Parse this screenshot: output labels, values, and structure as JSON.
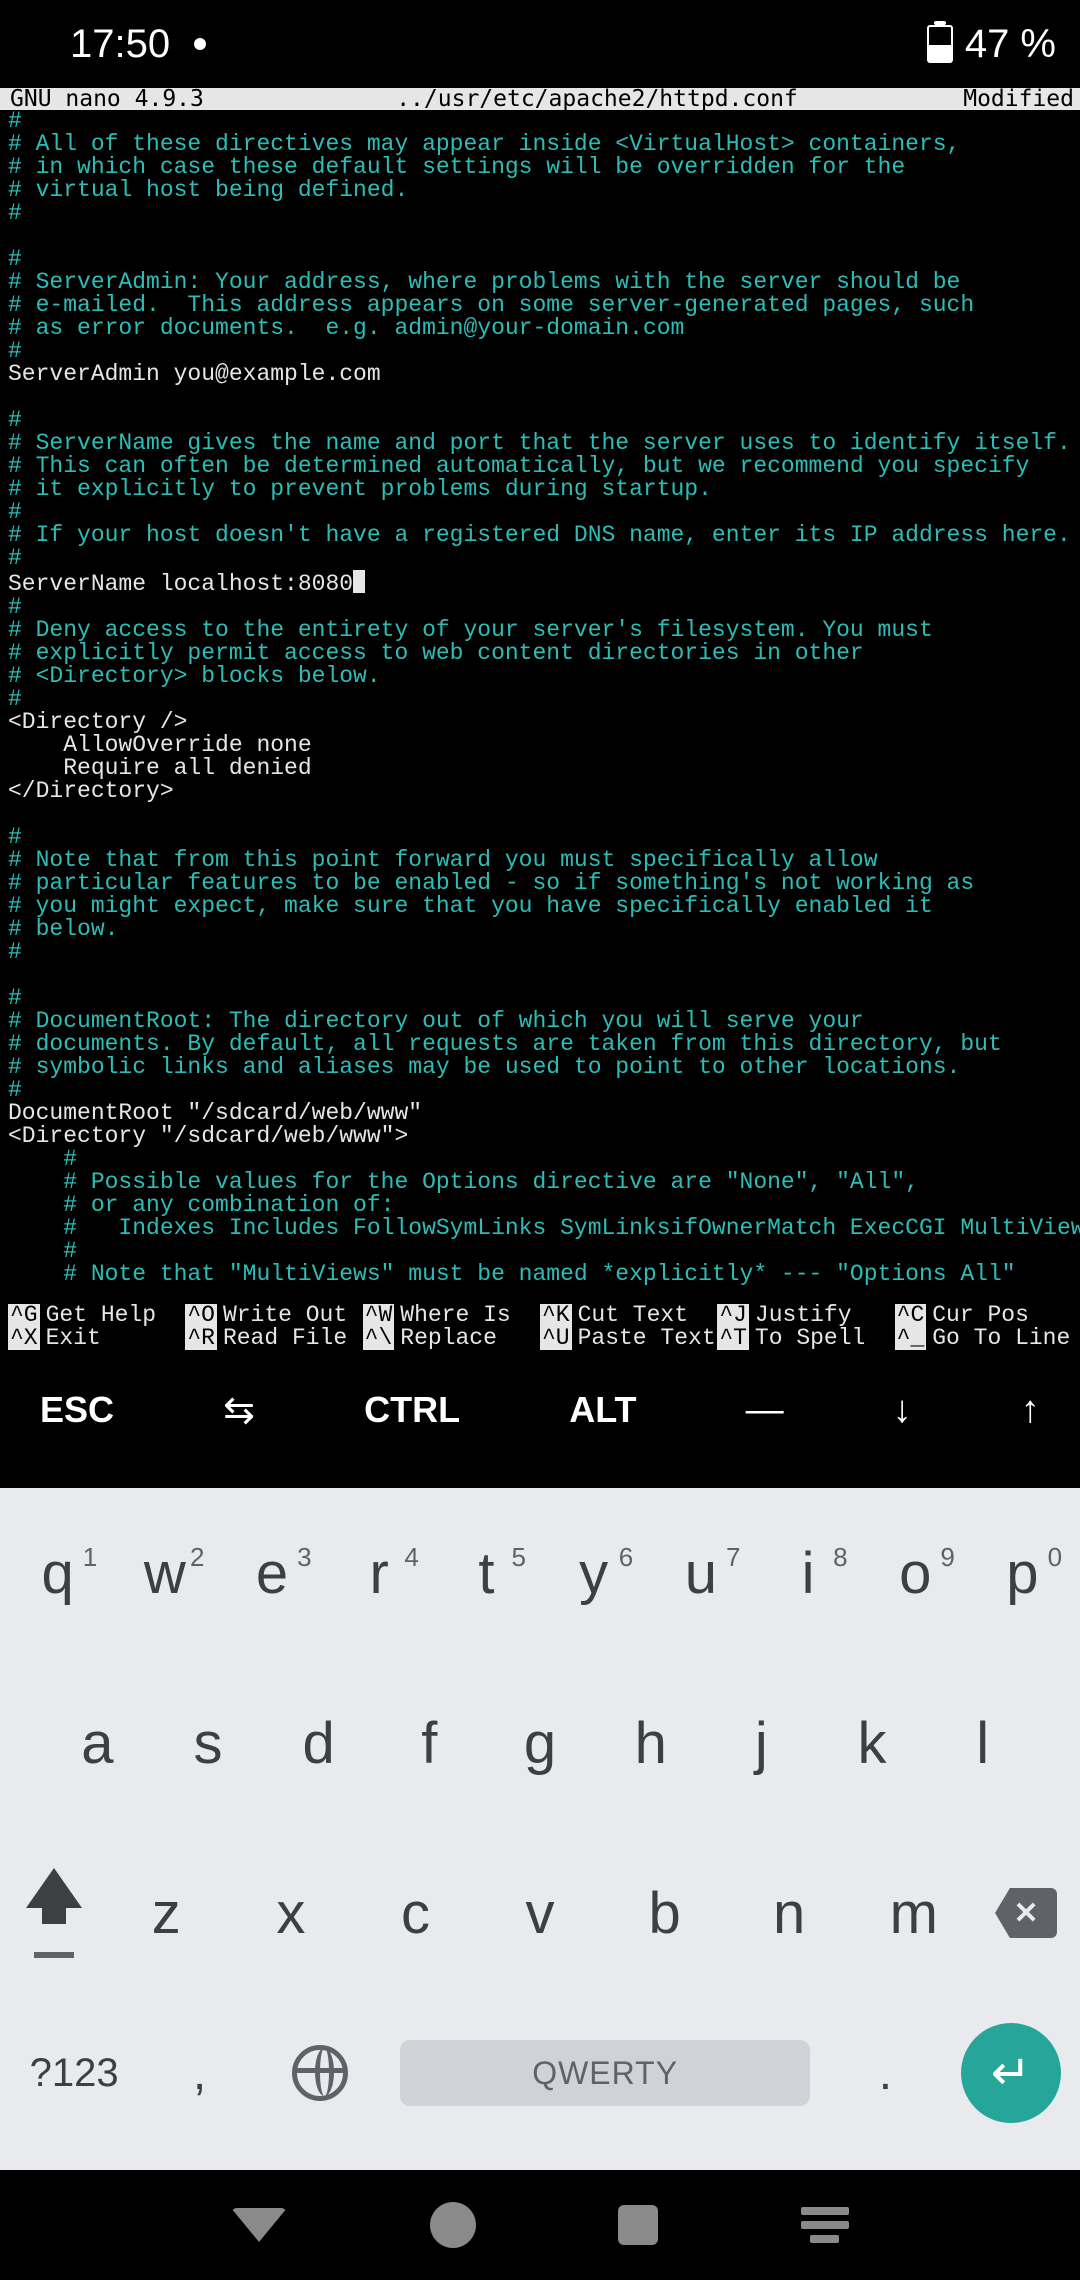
{
  "status": {
    "time": "17:50",
    "battery": "47 %"
  },
  "nano": {
    "app": "GNU nano 4.9.3",
    "file": "../usr/etc/apache2/httpd.conf",
    "state": "Modified",
    "lines": [
      {
        "t": "c",
        "v": "#"
      },
      {
        "t": "c",
        "v": "# All of these directives may appear inside <VirtualHost> containers,"
      },
      {
        "t": "c",
        "v": "# in which case these default settings will be overridden for the"
      },
      {
        "t": "c",
        "v": "# virtual host being defined."
      },
      {
        "t": "c",
        "v": "#"
      },
      {
        "t": "b",
        "v": ""
      },
      {
        "t": "c",
        "v": "#"
      },
      {
        "t": "c",
        "v": "# ServerAdmin: Your address, where problems with the server should be"
      },
      {
        "t": "c",
        "v": "# e-mailed.  This address appears on some server-generated pages, such"
      },
      {
        "t": "c",
        "v": "# as error documents.  e.g. admin@your-domain.com"
      },
      {
        "t": "c",
        "v": "#"
      },
      {
        "t": "p",
        "v": "ServerAdmin you@example.com"
      },
      {
        "t": "b",
        "v": ""
      },
      {
        "t": "c",
        "v": "#"
      },
      {
        "t": "c",
        "v": "# ServerName gives the name and port that the server uses to identify itself."
      },
      {
        "t": "c",
        "v": "# This can often be determined automatically, but we recommend you specify"
      },
      {
        "t": "c",
        "v": "# it explicitly to prevent problems during startup."
      },
      {
        "t": "c",
        "v": "#"
      },
      {
        "t": "c",
        "v": "# If your host doesn't have a registered DNS name, enter its IP address here."
      },
      {
        "t": "c",
        "v": "#"
      },
      {
        "t": "p",
        "v": "ServerName localhost:8080",
        "cursor": true
      },
      {
        "t": "c",
        "v": "#"
      },
      {
        "t": "c",
        "v": "# Deny access to the entirety of your server's filesystem. You must"
      },
      {
        "t": "c",
        "v": "# explicitly permit access to web content directories in other"
      },
      {
        "t": "c",
        "v": "# <Directory> blocks below."
      },
      {
        "t": "c",
        "v": "#"
      },
      {
        "t": "p",
        "v": "<Directory />"
      },
      {
        "t": "p",
        "v": "    AllowOverride none"
      },
      {
        "t": "p",
        "v": "    Require all denied"
      },
      {
        "t": "p",
        "v": "</Directory>"
      },
      {
        "t": "b",
        "v": ""
      },
      {
        "t": "c",
        "v": "#"
      },
      {
        "t": "c",
        "v": "# Note that from this point forward you must specifically allow"
      },
      {
        "t": "c",
        "v": "# particular features to be enabled - so if something's not working as"
      },
      {
        "t": "c",
        "v": "# you might expect, make sure that you have specifically enabled it"
      },
      {
        "t": "c",
        "v": "# below."
      },
      {
        "t": "c",
        "v": "#"
      },
      {
        "t": "b",
        "v": ""
      },
      {
        "t": "c",
        "v": "#"
      },
      {
        "t": "c",
        "v": "# DocumentRoot: The directory out of which you will serve your"
      },
      {
        "t": "c",
        "v": "# documents. By default, all requests are taken from this directory, but"
      },
      {
        "t": "c",
        "v": "# symbolic links and aliases may be used to point to other locations."
      },
      {
        "t": "c",
        "v": "#"
      },
      {
        "t": "p",
        "v": "DocumentRoot \"/sdcard/web/www\""
      },
      {
        "t": "p",
        "v": "<Directory \"/sdcard/web/www\">"
      },
      {
        "t": "c",
        "v": "    #"
      },
      {
        "t": "c",
        "v": "    # Possible values for the Options directive are \"None\", \"All\","
      },
      {
        "t": "c",
        "v": "    # or any combination of:"
      },
      {
        "t": "c",
        "v": "    #   Indexes Includes FollowSymLinks SymLinksifOwnerMatch ExecCGI MultiViews"
      },
      {
        "t": "c",
        "v": "    #"
      },
      {
        "t": "c",
        "v": "    # Note that \"MultiViews\" must be named *explicitly* --- \"Options All\""
      }
    ],
    "footer": [
      [
        {
          "k": "^G",
          "l": "Get Help"
        },
        {
          "k": "^O",
          "l": "Write Out"
        },
        {
          "k": "^W",
          "l": "Where Is"
        },
        {
          "k": "^K",
          "l": "Cut Text"
        },
        {
          "k": "^J",
          "l": "Justify"
        },
        {
          "k": "^C",
          "l": "Cur Pos"
        }
      ],
      [
        {
          "k": "^X",
          "l": "Exit"
        },
        {
          "k": "^R",
          "l": "Read File"
        },
        {
          "k": "^\\",
          "l": "Replace"
        },
        {
          "k": "^U",
          "l": "Paste Text"
        },
        {
          "k": "^T",
          "l": "To Spell"
        },
        {
          "k": "^_",
          "l": "Go To Line"
        }
      ]
    ]
  },
  "extrakeys": [
    "ESC",
    "⇆",
    "CTRL",
    "ALT",
    "―",
    "↓",
    "↑"
  ],
  "keyboard": {
    "row1": [
      {
        "k": "q",
        "n": "1"
      },
      {
        "k": "w",
        "n": "2"
      },
      {
        "k": "e",
        "n": "3"
      },
      {
        "k": "r",
        "n": "4"
      },
      {
        "k": "t",
        "n": "5"
      },
      {
        "k": "y",
        "n": "6"
      },
      {
        "k": "u",
        "n": "7"
      },
      {
        "k": "i",
        "n": "8"
      },
      {
        "k": "o",
        "n": "9"
      },
      {
        "k": "p",
        "n": "0"
      }
    ],
    "row2": [
      "a",
      "s",
      "d",
      "f",
      "g",
      "h",
      "j",
      "k",
      "l"
    ],
    "row3": [
      "z",
      "x",
      "c",
      "v",
      "b",
      "n",
      "m"
    ],
    "n123": "?123",
    "comma": ",",
    "space": "QWERTY",
    "period": "."
  }
}
